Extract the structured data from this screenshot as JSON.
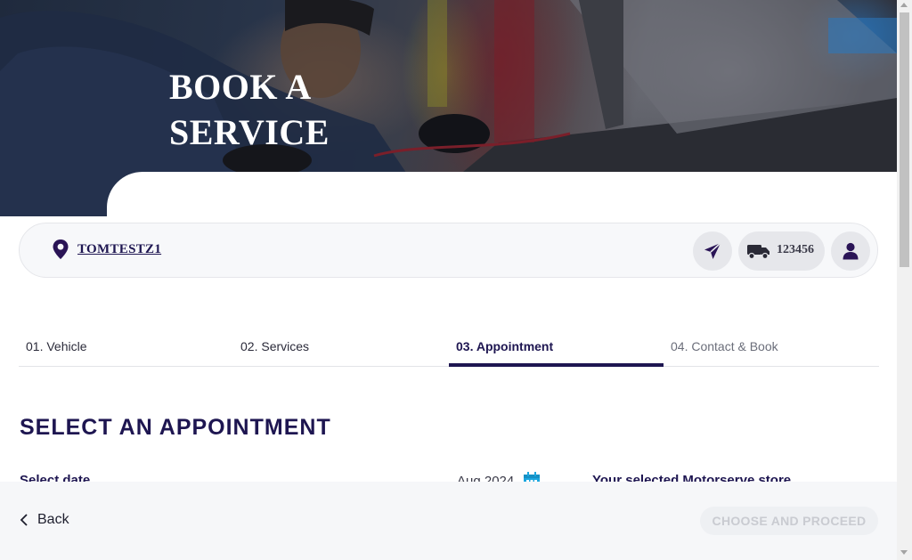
{
  "hero": {
    "title_line1": "BOOK A",
    "title_line2": "SERVICE"
  },
  "store_bar": {
    "location_icon": "map-pin-icon",
    "store_name": "TOMTESTZ1",
    "send_icon": "paper-plane-icon",
    "vehicle_icon": "truck-icon",
    "rego": "123456",
    "account_icon": "user-icon"
  },
  "tabs": [
    {
      "label": "01. Vehicle",
      "state": "done"
    },
    {
      "label": "02. Services",
      "state": "done"
    },
    {
      "label": "03. Appointment",
      "state": "active"
    },
    {
      "label": "04. Contact & Book",
      "state": "pending"
    }
  ],
  "main": {
    "section_title": "SELECT AN APPOINTMENT",
    "select_date_label": "Select date",
    "month_label": "Aug 2024",
    "calendar_icon": "calendar-icon",
    "store_heading": "Your selected Motorserve store"
  },
  "footer": {
    "back_icon": "chevron-left-icon",
    "back_label": "Back",
    "proceed_label": "CHOOSE AND PROCEED",
    "proceed_enabled": false
  },
  "colors": {
    "brand_navy": "#1e1651",
    "accent_cyan": "#1aa6df",
    "muted_text": "#6b6e7a",
    "footer_bg": "#f6f7f9"
  }
}
